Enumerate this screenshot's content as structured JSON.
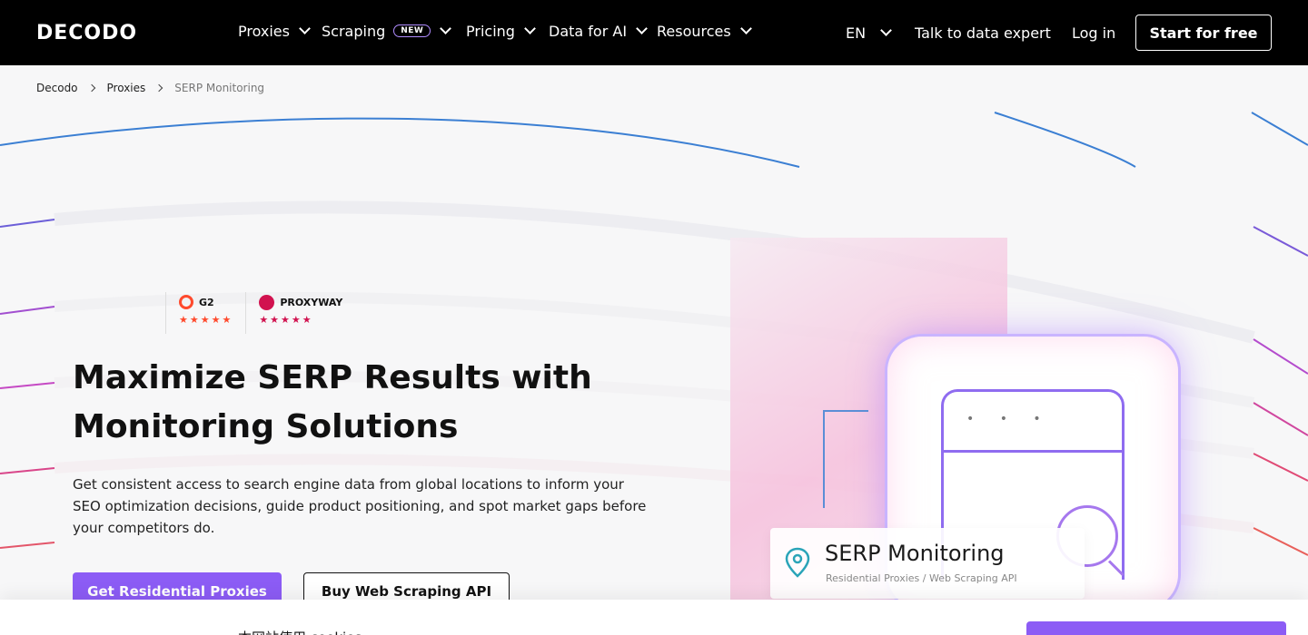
{
  "nav": {
    "logo": "DECODO",
    "items": [
      {
        "label": "Proxies"
      },
      {
        "label": "Scraping",
        "badge": "NEW"
      },
      {
        "label": "Pricing"
      },
      {
        "label": "Data for AI"
      },
      {
        "label": "Resources"
      }
    ],
    "language": "EN",
    "talk_label": "Talk to data expert",
    "login_label": "Log in",
    "start_label": "Start for free"
  },
  "breadcrumb": [
    "Decodo",
    "Proxies",
    "SERP Monitoring"
  ],
  "ratings": [
    {
      "name": "G2",
      "stars": "★★★★★",
      "score": 4.5
    },
    {
      "name": "PROXYWAY",
      "stars": "★★★★★",
      "score": 4.5
    }
  ],
  "hero": {
    "title": "Maximize SERP Results with Monitoring Solutions",
    "subtitle": "Get consistent access to search engine data from global locations to inform your SEO optimization decisions, guide product positioning, and spot market gaps before your competitors do.",
    "primary_button": "Get Residential Proxies",
    "secondary_button": "Buy Web Scraping API"
  },
  "illustration": {
    "dots": "• • •",
    "card_title": "SERP Monitoring",
    "card_subtitle": "Residential Proxies / Web Scraping API"
  },
  "bottom": {
    "text": "本网站使用 cookies"
  },
  "colors": {
    "accent": "#8c5cf5",
    "nav_bg": "#000000",
    "g2": "#ff492c",
    "proxyway": "#d1124f"
  }
}
